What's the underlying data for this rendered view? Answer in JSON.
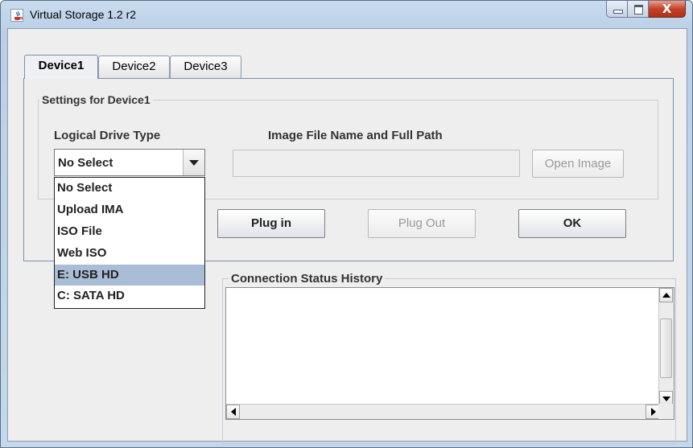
{
  "window": {
    "title": "Virtual Storage 1.2 r2",
    "close_glyph": "X"
  },
  "tabs": [
    {
      "label": "Device1",
      "active": true
    },
    {
      "label": "Device2",
      "active": false
    },
    {
      "label": "Device3",
      "active": false
    }
  ],
  "settings": {
    "group_title": "Settings for Device1",
    "drive_type_label": "Logical Drive Type",
    "drive_type_value": "No Select",
    "image_path_label": "Image File Name and Full Path",
    "image_path_value": "",
    "open_image_label": "Open Image"
  },
  "dropdown": {
    "options": [
      "No Select",
      "Upload IMA",
      "ISO File",
      "Web ISO",
      "E: USB HD",
      "C: SATA HD"
    ],
    "highlighted_index": 4
  },
  "actions": {
    "plug_in_label": "Plug in",
    "plug_out_label": "Plug Out",
    "ok_label": "OK"
  },
  "history": {
    "group_title": "Connection Status History",
    "content": ""
  },
  "colors": {
    "selection_highlight": "#a9bdd6",
    "close_button": "#c4412a"
  },
  "icons": {
    "app": "java-cup-icon"
  }
}
